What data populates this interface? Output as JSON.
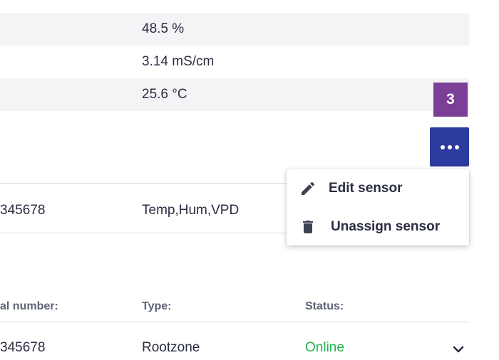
{
  "readings": [
    {
      "value": "48.5 %"
    },
    {
      "value": "3.14 mS/cm"
    },
    {
      "value": "25.6 °C"
    }
  ],
  "step_badge": "3",
  "sensor_row": {
    "serial": "345678",
    "type": "Temp,Hum,VPD"
  },
  "table": {
    "headers": {
      "serial": "al number:",
      "type": "Type:",
      "status": "Status:"
    },
    "rows": [
      {
        "serial": "345678",
        "type": "Rootzone",
        "status": "Online"
      }
    ]
  },
  "context_menu": {
    "items": [
      {
        "label": "Edit sensor",
        "icon": "pencil-icon"
      },
      {
        "label": "Unassign sensor",
        "icon": "trash-icon"
      }
    ]
  },
  "colors": {
    "accent": "#2e3b9e",
    "badge": "#7b3f98",
    "online": "#21b14e",
    "row_shade": "#f4f4f6"
  }
}
